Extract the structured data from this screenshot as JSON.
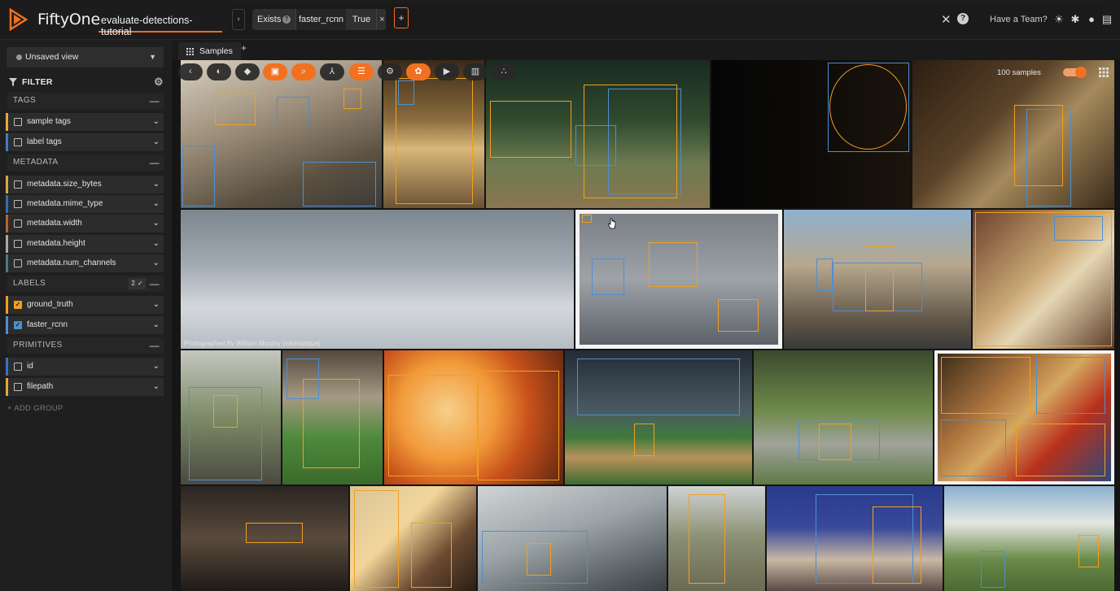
{
  "header": {
    "app_name": "FiftyOne",
    "dataset_name": "evaluate-detections-tutorial",
    "filter": {
      "operator": "Exists",
      "field": "faster_rcnn",
      "value": "True"
    },
    "team_link": "Have a Team?",
    "accent_color": "#f27121"
  },
  "sidebar": {
    "view_select": "Unsaved view",
    "filter_title": "FILTER",
    "add_group": "+ ADD GROUP",
    "groups": [
      {
        "title": "TAGS",
        "fields": [
          {
            "name": "sample tags",
            "color": "#e8a93a",
            "checked": false
          },
          {
            "name": "label tags",
            "color": "#3b7fc4",
            "checked": false
          }
        ]
      },
      {
        "title": "METADATA",
        "fields": [
          {
            "name": "metadata.size_bytes",
            "color": "#d9a845",
            "checked": false
          },
          {
            "name": "metadata.mime_type",
            "color": "#2f6fb3",
            "checked": false
          },
          {
            "name": "metadata.width",
            "color": "#b8622a",
            "checked": false
          },
          {
            "name": "metadata.height",
            "color": "#a8a8a8",
            "checked": false
          },
          {
            "name": "metadata.num_channels",
            "color": "#4f7a7a",
            "checked": false
          }
        ]
      },
      {
        "title": "LABELS",
        "count": "2 ✓",
        "fields": [
          {
            "name": "ground_truth",
            "color": "#f0a020",
            "checked": true
          },
          {
            "name": "faster_rcnn",
            "color": "#4e8fd1",
            "checked": true
          }
        ]
      },
      {
        "title": "PRIMITIVES",
        "fields": [
          {
            "name": "id",
            "color": "#3576c2",
            "checked": false
          },
          {
            "name": "filepath",
            "color": "#e6a73d",
            "checked": false
          }
        ]
      }
    ]
  },
  "tabs": [
    {
      "label": "Samples"
    }
  ],
  "grid": {
    "sample_count": "100 samples",
    "caption": "Photographed By William Murphy (infomatique)"
  },
  "toolbar_icons": [
    "chevron-left-icon",
    "palette-icon",
    "tag-icon",
    "patches-icon",
    "search-icon",
    "similarity-icon",
    "list-icon",
    "settings-icon",
    "openai-icon",
    "youtube-icon",
    "chart-icon",
    "cluster-icon"
  ]
}
